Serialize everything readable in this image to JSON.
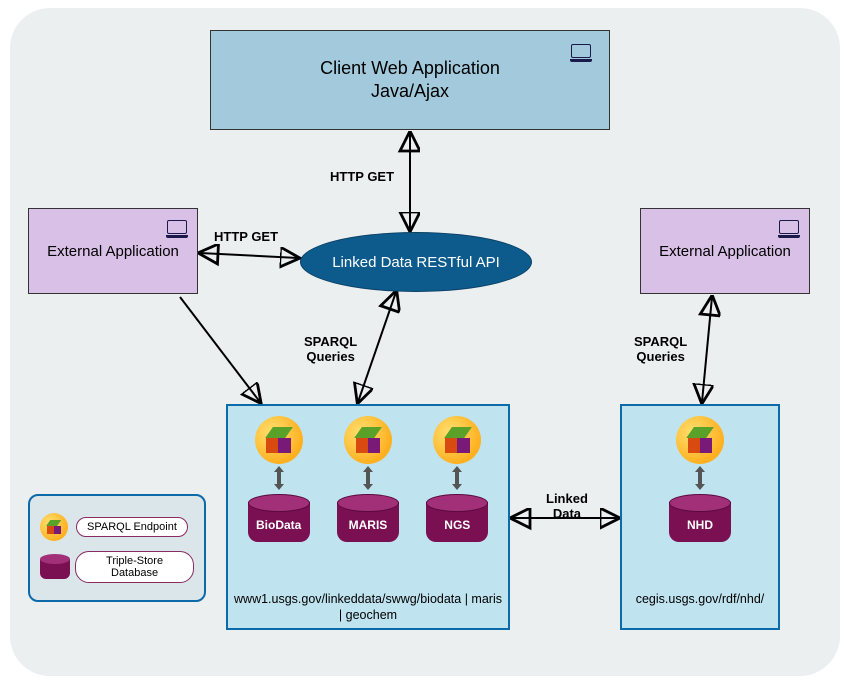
{
  "client": {
    "line1": "Client Web Application",
    "line2": "Java/Ajax"
  },
  "ext_left": {
    "label": "External Application"
  },
  "ext_right": {
    "label": "External Application"
  },
  "api": {
    "label": "Linked Data RESTful API"
  },
  "edges": {
    "http_get_top": "HTTP GET",
    "http_get_left": "HTTP GET",
    "sparql_left": "SPARQL\nQueries",
    "sparql_right": "SPARQL\nQueries",
    "linked_data": "Linked\nData"
  },
  "datasources_left": {
    "items": [
      {
        "name": "BioData"
      },
      {
        "name": "MARIS"
      },
      {
        "name": "NGS"
      }
    ],
    "url": "www1.usgs.gov/linkeddata/swwg/biodata | maris | geochem"
  },
  "datasources_right": {
    "items": [
      {
        "name": "NHD"
      }
    ],
    "url": "cegis.usgs.gov/rdf/nhd/"
  },
  "legend": {
    "sparql": "SPARQL Endpoint",
    "triple": "Triple-Store Database"
  }
}
